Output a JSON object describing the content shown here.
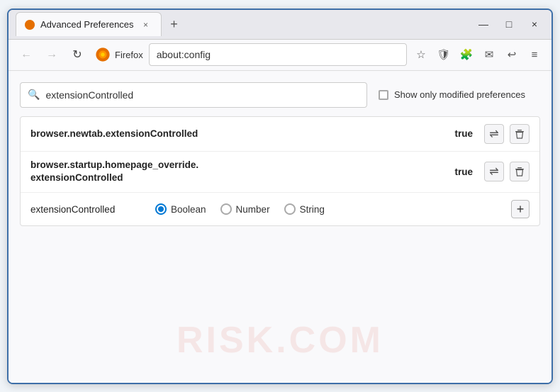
{
  "window": {
    "title": "Advanced Preferences",
    "tab_label": "Advanced Preferences",
    "close_label": "×",
    "new_tab_label": "+",
    "minimize_label": "—",
    "maximize_label": "□",
    "window_close_label": "×"
  },
  "toolbar": {
    "back_icon": "←",
    "forward_icon": "→",
    "reload_icon": "↻",
    "browser_name": "Firefox",
    "address": "about:config",
    "bookmark_icon": "☆",
    "pocket_icon": "🛡",
    "extension_icon": "🧩",
    "sync_icon": "✉",
    "back2_icon": "↩",
    "menu_icon": "≡"
  },
  "search": {
    "placeholder": "extensionControlled",
    "value": "extensionControlled",
    "checkbox_label": "Show only modified preferences"
  },
  "preferences": {
    "rows": [
      {
        "name": "browser.newtab.extensionControlled",
        "value": "true",
        "multiline": false
      },
      {
        "name": "browser.startup.homepage_override.\nextensionControlled",
        "name_line1": "browser.startup.homepage_override.",
        "name_line2": "extensionControlled",
        "value": "true",
        "multiline": true
      }
    ],
    "new_pref": {
      "name": "extensionControlled",
      "types": [
        {
          "label": "Boolean",
          "selected": true
        },
        {
          "label": "Number",
          "selected": false
        },
        {
          "label": "String",
          "selected": false
        }
      ],
      "add_label": "+"
    },
    "toggle_icon": "⇌",
    "delete_icon": "🗑"
  },
  "watermark": {
    "text": "RISK.COM"
  }
}
